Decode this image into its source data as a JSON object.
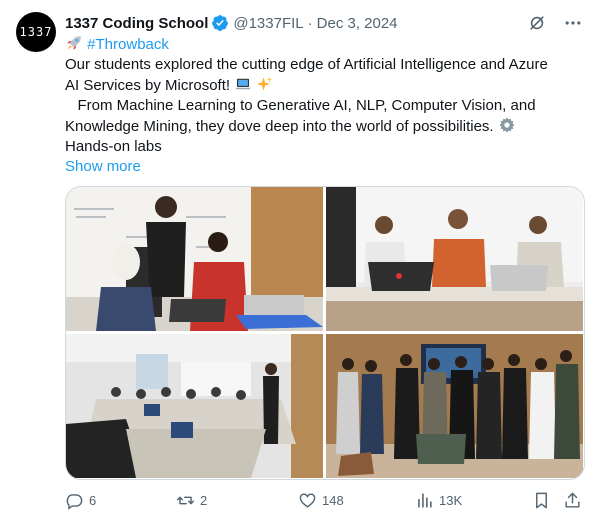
{
  "author": {
    "avatar_text": "1337",
    "name": "1337 Coding School",
    "handle": "@1337FIL",
    "separator": "·",
    "date": "Dec 3, 2024"
  },
  "tweet": {
    "lines": [
      {
        "emoji": "rocket-emoji",
        "text": "#Throwback"
      },
      {
        "text": "Our students explored the cutting edge of Artificial Intelligence and Azure"
      },
      {
        "text": "AI Services by Microsoft!",
        "emojis": [
          "laptop-emoji",
          "sparkles-emoji"
        ]
      },
      {
        "text": "   From Machine Learning to Generative AI, NLP, Computer Vision, and"
      },
      {
        "text": "Knowledge Mining, they dove deep into the world of possibilities.",
        "emojis": [
          "gear-emoji"
        ]
      },
      {
        "text": "Hands-on labs"
      }
    ],
    "show_more": "Show more"
  },
  "media": [
    {
      "description": "Students at laptops near whiteboard"
    },
    {
      "description": "Students seated at table with laptops"
    },
    {
      "description": "Classroom with presenter and students"
    },
    {
      "description": "Group photo of students"
    }
  ],
  "actions": {
    "replies": "6",
    "reposts": "2",
    "likes": "148",
    "views": "13K"
  },
  "colors": {
    "accent": "#1d9bf0",
    "secondary_text": "#536471",
    "primary_text": "#0f1419"
  }
}
